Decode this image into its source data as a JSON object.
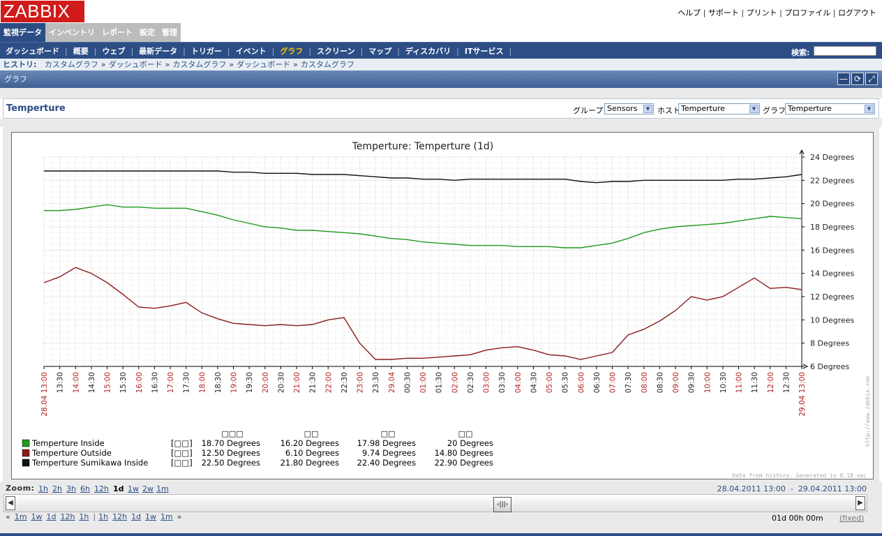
{
  "logo": "ZABBIX",
  "top_links": [
    "ヘルプ",
    "サポート",
    "プリント",
    "プロファイル",
    "ログアウト"
  ],
  "main_tabs": [
    {
      "label": "監視データ",
      "active": true
    },
    {
      "label": "インベントリ",
      "active": false
    },
    {
      "label": "レポート",
      "active": false
    },
    {
      "label": "設定",
      "active": false
    },
    {
      "label": "管理",
      "active": false
    }
  ],
  "submenu": [
    {
      "label": "ダッシュボード",
      "active": false
    },
    {
      "label": "概要",
      "active": false
    },
    {
      "label": "ウェブ",
      "active": false
    },
    {
      "label": "最新データ",
      "active": false
    },
    {
      "label": "トリガー",
      "active": false
    },
    {
      "label": "イベント",
      "active": false
    },
    {
      "label": "グラフ",
      "active": true
    },
    {
      "label": "スクリーン",
      "active": false
    },
    {
      "label": "マップ",
      "active": false
    },
    {
      "label": "ディスカバリ",
      "active": false
    },
    {
      "label": "ITサービス",
      "active": false
    }
  ],
  "search": {
    "label": "検索:",
    "value": ""
  },
  "history": {
    "label": "ヒストリ:",
    "crumbs": [
      "カスタムグラフ",
      "ダッシュボード",
      "カスタムグラフ",
      "ダッシュボード",
      "カスタムグラフ"
    ],
    "separator": "»"
  },
  "section_title": "グラフ",
  "section_buttons": [
    {
      "icon": "minimize-icon",
      "glyph": "—"
    },
    {
      "icon": "refresh-icon",
      "glyph": "⟳"
    },
    {
      "icon": "fullscreen-icon",
      "glyph": "⤢"
    }
  ],
  "page_title": "Temperture",
  "filters": {
    "group_label": "グループ",
    "group_value": "Sensors",
    "host_label": "ホスト",
    "host_value": "Temperture",
    "graph_label": "グラフ",
    "graph_value": "Temperture"
  },
  "chart_data": {
    "type": "line",
    "title": "Temperture: Temperture  (1d)",
    "ylim": [
      6,
      24
    ],
    "yticks": [
      6,
      8,
      10,
      12,
      14,
      16,
      18,
      20,
      22,
      24
    ],
    "yunit": "Degrees",
    "grid": true,
    "x_tick_labels": [
      "28.04 13:00",
      "13:30",
      "14:00",
      "14:30",
      "15:00",
      "15:30",
      "16:00",
      "16:30",
      "17:00",
      "17:30",
      "18:00",
      "18:30",
      "19:00",
      "19:30",
      "20:00",
      "20:30",
      "21:00",
      "21:30",
      "22:00",
      "22:30",
      "23:00",
      "23:30",
      "29.04",
      "00:30",
      "01:00",
      "01:30",
      "02:00",
      "02:30",
      "03:00",
      "03:30",
      "04:00",
      "04:30",
      "05:00",
      "05:30",
      "06:00",
      "06:30",
      "07:00",
      "07:30",
      "08:00",
      "08:30",
      "09:00",
      "09:30",
      "10:00",
      "10:30",
      "11:00",
      "11:30",
      "12:00",
      "12:30",
      "29.04 13:00"
    ],
    "x_hours": [
      13,
      13.5,
      14,
      14.5,
      15,
      15.5,
      16,
      16.5,
      17,
      17.5,
      18,
      18.5,
      19,
      19.5,
      20,
      20.5,
      21,
      21.5,
      22,
      22.5,
      23,
      23.5,
      24,
      24.5,
      25,
      25.5,
      26,
      26.5,
      27,
      27.5,
      28,
      28.5,
      29,
      29.5,
      30,
      30.5,
      31,
      31.5,
      32,
      32.5,
      33,
      33.5,
      34,
      34.5,
      35,
      35.5,
      36,
      36.5,
      37
    ],
    "series": [
      {
        "name": "Temperture Inside",
        "color": "#1f9a1f",
        "values": [
          19.4,
          19.4,
          19.5,
          19.7,
          19.9,
          19.7,
          19.7,
          19.6,
          19.6,
          19.6,
          19.3,
          19.0,
          18.6,
          18.3,
          18.0,
          17.9,
          17.7,
          17.7,
          17.6,
          17.5,
          17.4,
          17.2,
          17.0,
          16.9,
          16.7,
          16.6,
          16.5,
          16.4,
          16.4,
          16.4,
          16.3,
          16.3,
          16.3,
          16.2,
          16.2,
          16.4,
          16.6,
          17.0,
          17.5,
          17.8,
          18.0,
          18.1,
          18.2,
          18.3,
          18.5,
          18.7,
          18.9,
          18.8,
          18.7
        ]
      },
      {
        "name": "Temperture Outside",
        "color": "#8b1a1a",
        "values": [
          13.2,
          13.7,
          14.5,
          14.0,
          13.2,
          12.2,
          11.1,
          11.0,
          11.2,
          11.5,
          10.6,
          10.1,
          9.7,
          9.6,
          9.5,
          9.6,
          9.5,
          9.6,
          10.0,
          10.2,
          8.0,
          6.6,
          6.6,
          6.7,
          6.7,
          6.8,
          6.9,
          7.0,
          7.4,
          7.6,
          7.7,
          7.4,
          7.0,
          6.9,
          6.6,
          6.9,
          7.2,
          8.7,
          9.2,
          9.9,
          10.8,
          12.0,
          11.7,
          12.0,
          12.8,
          13.6,
          12.7,
          12.8,
          12.6
        ]
      },
      {
        "name": "Temperture Sumikawa Inside",
        "color": "#111111",
        "values": [
          22.8,
          22.8,
          22.8,
          22.8,
          22.8,
          22.8,
          22.8,
          22.8,
          22.8,
          22.8,
          22.8,
          22.8,
          22.7,
          22.7,
          22.6,
          22.6,
          22.6,
          22.5,
          22.5,
          22.5,
          22.4,
          22.3,
          22.2,
          22.2,
          22.1,
          22.1,
          22.0,
          22.1,
          22.1,
          22.1,
          22.1,
          22.1,
          22.1,
          22.1,
          21.9,
          21.8,
          21.9,
          21.9,
          22.0,
          22.0,
          22.0,
          22.0,
          22.0,
          22.0,
          22.1,
          22.1,
          22.2,
          22.3,
          22.5
        ]
      }
    ],
    "legend": {
      "headers": [
        "□□□",
        "□□",
        "□□",
        "□□"
      ],
      "rows": [
        {
          "name": "Temperture Inside",
          "tag": "[□□]",
          "last": "18.70 Degrees",
          "min": "16.20 Degrees",
          "avg": "17.98 Degrees",
          "max": "20 Degrees"
        },
        {
          "name": "Temperture Outside",
          "tag": "[□□]",
          "last": "12.50 Degrees",
          "min": "6.10 Degrees",
          "avg": "9.74 Degrees",
          "max": "14.80 Degrees"
        },
        {
          "name": "Temperture Sumikawa Inside",
          "tag": "[□□]",
          "last": "22.50 Degrees",
          "min": "21.80 Degrees",
          "avg": "22.40 Degrees",
          "max": "22.90 Degrees"
        }
      ]
    },
    "side_text": "http://www.zabbix.com",
    "footer_text": "Data from history. Generated in 0.18 sec"
  },
  "zoom": {
    "label": "Zoom:",
    "links": [
      "1h",
      "2h",
      "3h",
      "6h",
      "12h",
      "1d",
      "1w",
      "2w",
      "1m"
    ],
    "current": "1d",
    "range_from": "28.04.2011 13:00",
    "range_sep": "-",
    "range_to": "29.04.2011 13:00"
  },
  "nav": {
    "back": "«",
    "back_links": [
      "1m",
      "1w",
      "1d",
      "12h",
      "1h"
    ],
    "sep": "|",
    "fwd_links": [
      "1h",
      "12h",
      "1d",
      "1w",
      "1m"
    ],
    "fwd": "»",
    "period": "01d 00h 00m",
    "fixed": "(fixed)"
  }
}
